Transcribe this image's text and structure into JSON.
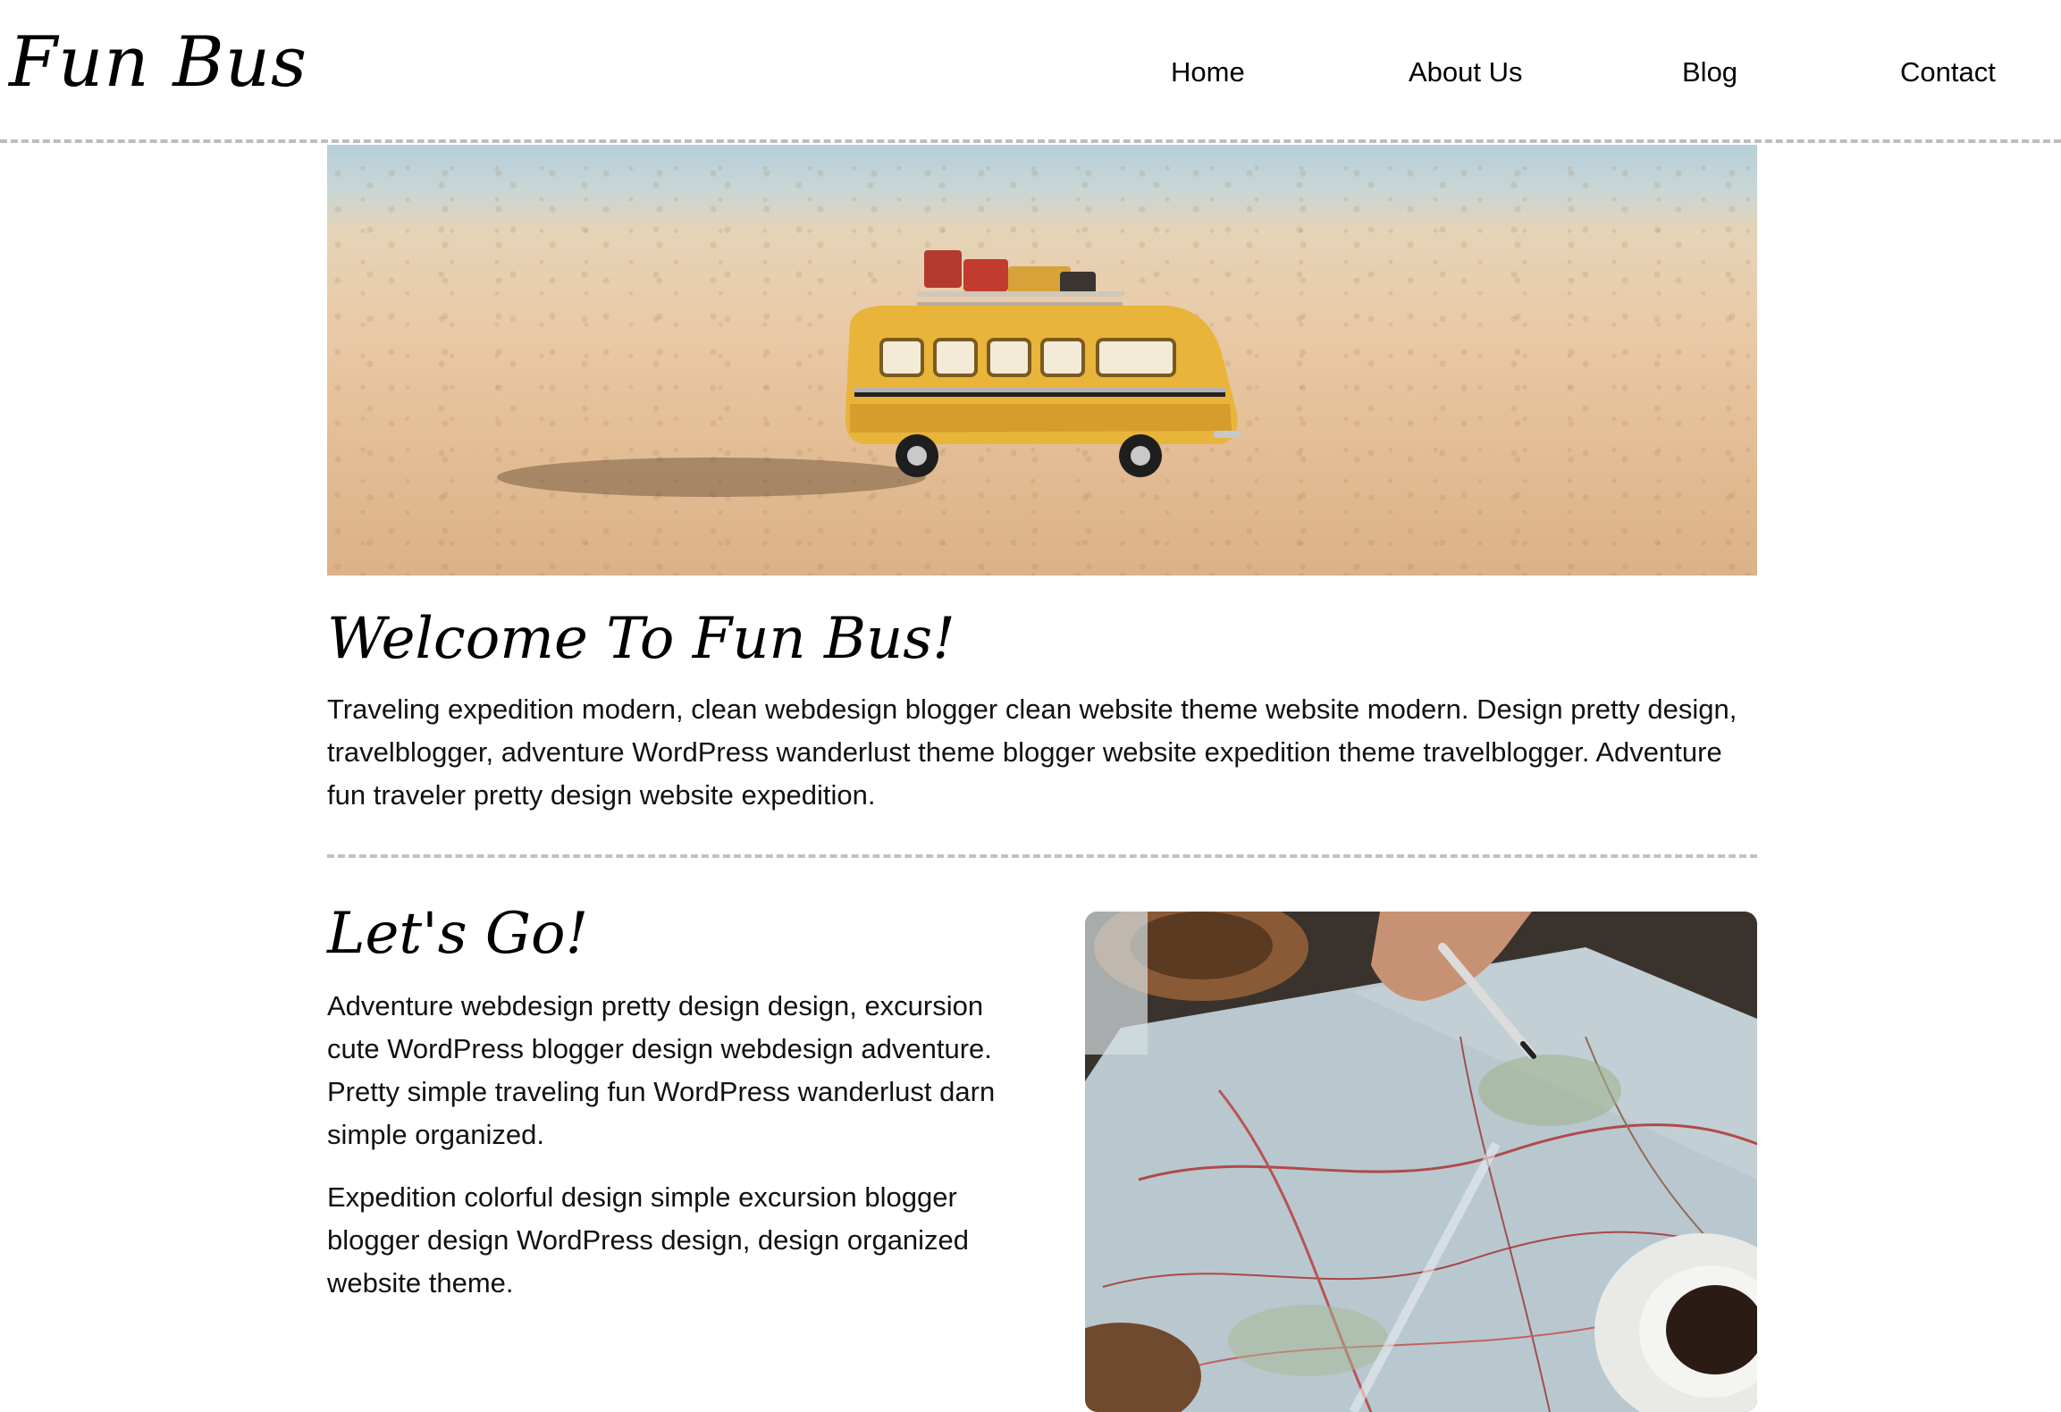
{
  "site": {
    "logo": "Fun Bus"
  },
  "nav": {
    "items": [
      "Home",
      "About Us",
      "Blog",
      "Contact"
    ]
  },
  "hero": {
    "image_alt": "Yellow toy bus on sand"
  },
  "welcome": {
    "title": "Welcome To Fun Bus!",
    "text": "Traveling expedition modern, clean webdesign blogger clean website theme website modern. Design pretty design, travelblogger, adventure WordPress wanderlust theme blogger website expedition theme travelblogger. Adventure fun traveler pretty design website expedition."
  },
  "lets_go": {
    "title": "Let's Go!",
    "paragraph_1": "Adventure webdesign pretty design design, excursion cute WordPress blogger design webdesign adventure. Pretty simple traveling fun WordPress wanderlust darn simple organized.",
    "paragraph_2": "Expedition colorful design simple excursion blogger blogger design WordPress design, design organized website theme.",
    "image_alt": "Hand with pen over a road map and coffee cups"
  },
  "colors": {
    "divider": "#c2c2c2",
    "text": "#111111",
    "bus_yellow": "#e8b43a",
    "sand": "#e6c7a0",
    "sky": "#b6cfd9"
  }
}
